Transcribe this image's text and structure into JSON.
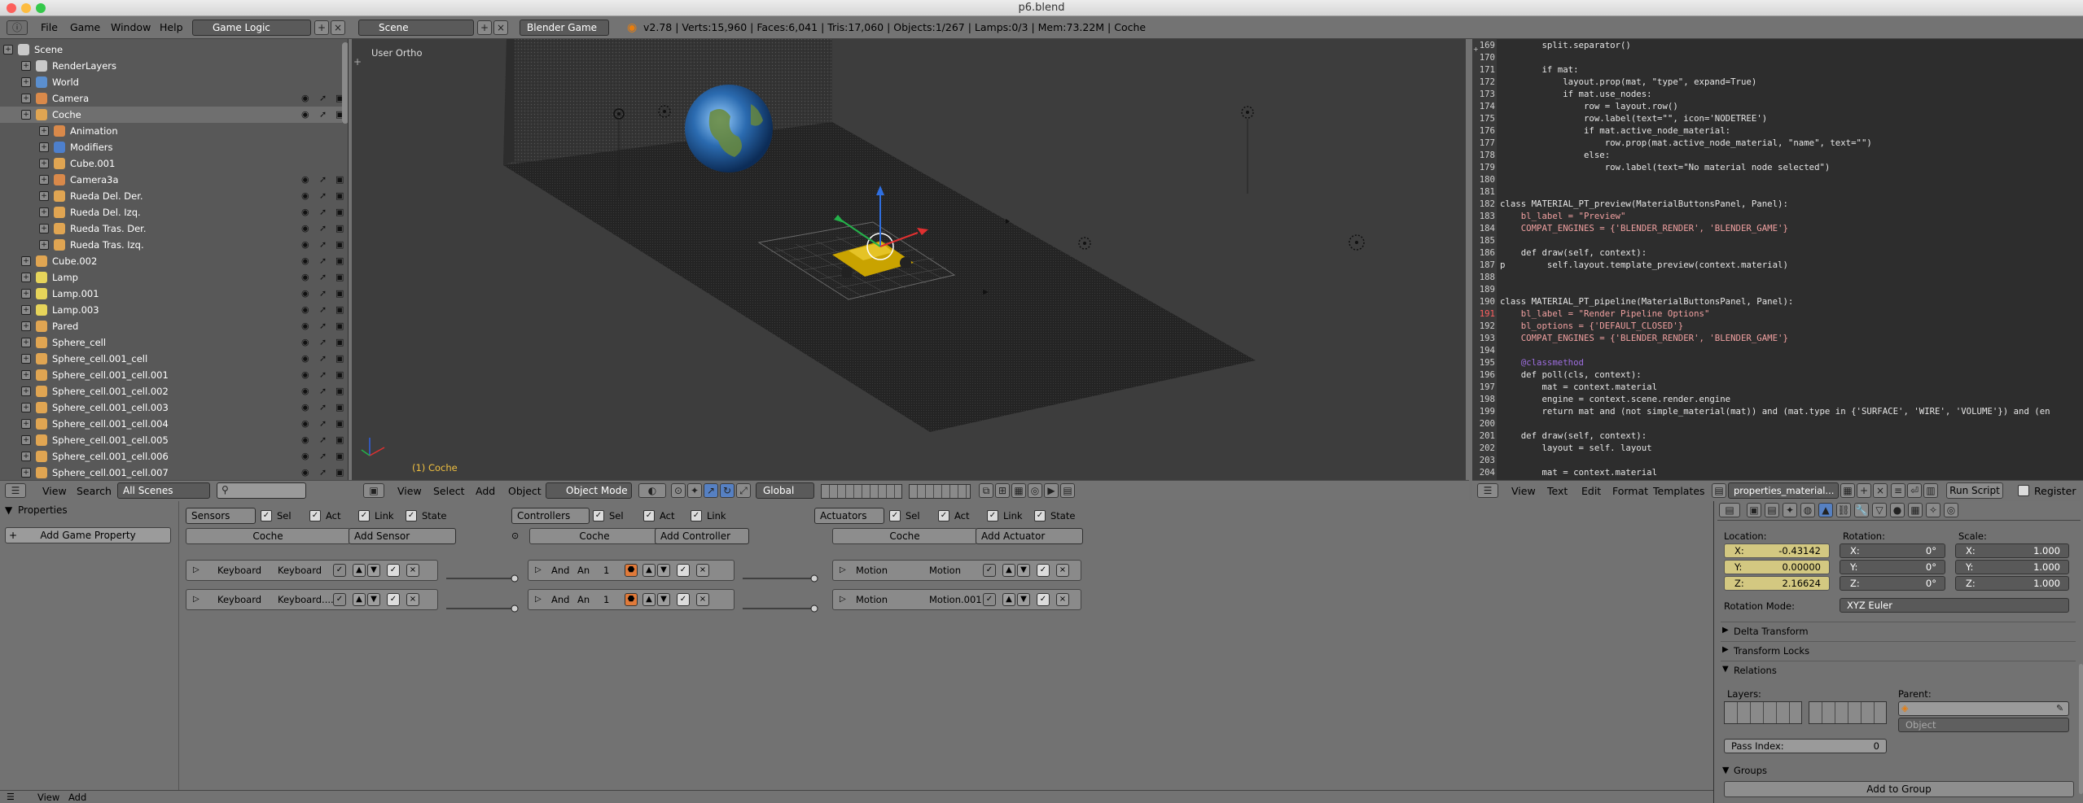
{
  "window": {
    "title": "p6.blend"
  },
  "topbar": {
    "menus": [
      "File",
      "Game",
      "Window",
      "Help"
    ],
    "screen_layout": "Game Logic",
    "scene": "Scene",
    "engine": "Blender Game",
    "stats": "v2.78 | Verts:15,960 | Faces:6,041 | Tris:17,060 | Objects:1/267 | Lamps:0/3 | Mem:73.22M | Coche"
  },
  "outliner": {
    "items": [
      {
        "label": "Scene",
        "indent": 0,
        "icon": "scene-icon"
      },
      {
        "label": "RenderLayers",
        "indent": 1,
        "icon": "renderlayers-icon"
      },
      {
        "label": "World",
        "indent": 1,
        "icon": "world-icon"
      },
      {
        "label": "Camera",
        "indent": 1,
        "icon": "camera-icon"
      },
      {
        "label": "Coche",
        "indent": 1,
        "icon": "mesh-icon"
      },
      {
        "label": "Animation",
        "indent": 2,
        "icon": "animation-icon"
      },
      {
        "label": "Modifiers",
        "indent": 2,
        "icon": "modifier-icon"
      },
      {
        "label": "Cube.001",
        "indent": 2,
        "icon": "mesh-icon"
      },
      {
        "label": "Camera3a",
        "indent": 2,
        "icon": "camera-icon"
      },
      {
        "label": "Rueda Del. Der.",
        "indent": 2,
        "icon": "mesh-icon"
      },
      {
        "label": "Rueda Del. Izq.",
        "indent": 2,
        "icon": "mesh-icon"
      },
      {
        "label": "Rueda Tras. Der.",
        "indent": 2,
        "icon": "mesh-icon"
      },
      {
        "label": "Rueda Tras. Izq.",
        "indent": 2,
        "icon": "mesh-icon"
      },
      {
        "label": "Cube.002",
        "indent": 1,
        "icon": "mesh-icon"
      },
      {
        "label": "Lamp",
        "indent": 1,
        "icon": "lamp-icon"
      },
      {
        "label": "Lamp.001",
        "indent": 1,
        "icon": "lamp-icon"
      },
      {
        "label": "Lamp.003",
        "indent": 1,
        "icon": "lamp-icon"
      },
      {
        "label": "Pared",
        "indent": 1,
        "icon": "mesh-icon"
      },
      {
        "label": "Sphere_cell",
        "indent": 1,
        "icon": "mesh-icon"
      },
      {
        "label": "Sphere_cell.001_cell",
        "indent": 1,
        "icon": "mesh-icon"
      },
      {
        "label": "Sphere_cell.001_cell.001",
        "indent": 1,
        "icon": "mesh-icon"
      },
      {
        "label": "Sphere_cell.001_cell.002",
        "indent": 1,
        "icon": "mesh-icon"
      },
      {
        "label": "Sphere_cell.001_cell.003",
        "indent": 1,
        "icon": "mesh-icon"
      },
      {
        "label": "Sphere_cell.001_cell.004",
        "indent": 1,
        "icon": "mesh-icon"
      },
      {
        "label": "Sphere_cell.001_cell.005",
        "indent": 1,
        "icon": "mesh-icon"
      },
      {
        "label": "Sphere_cell.001_cell.006",
        "indent": 1,
        "icon": "mesh-icon"
      },
      {
        "label": "Sphere_cell.001_cell.007",
        "indent": 1,
        "icon": "mesh-icon"
      }
    ],
    "header": {
      "menus": [
        "View",
        "Search"
      ],
      "filter": "All Scenes"
    }
  },
  "viewport": {
    "label": "User Ortho",
    "object_label": "(1) Coche",
    "header": {
      "menus": [
        "View",
        "Select",
        "Add",
        "Object"
      ],
      "mode": "Object Mode",
      "orientation": "Global"
    }
  },
  "text_editor": {
    "lines": [
      {
        "n": "169",
        "t": "        split.separator()"
      },
      {
        "n": "170",
        "t": ""
      },
      {
        "n": "171",
        "t": "        if mat:"
      },
      {
        "n": "172",
        "t": "            layout.prop(mat, \"type\", expand=True)"
      },
      {
        "n": "173",
        "t": "            if mat.use_nodes:"
      },
      {
        "n": "174",
        "t": "                row = layout.row()"
      },
      {
        "n": "175",
        "t": "                row.label(text=\"\", icon='NODETREE')"
      },
      {
        "n": "176",
        "t": "                if mat.active_node_material:"
      },
      {
        "n": "177",
        "t": "                    row.prop(mat.active_node_material, \"name\", text=\"\")"
      },
      {
        "n": "178",
        "t": "                else:"
      },
      {
        "n": "179",
        "t": "                    row.label(text=\"No material node selected\")"
      },
      {
        "n": "180",
        "t": ""
      },
      {
        "n": "181",
        "t": ""
      },
      {
        "n": "182",
        "t": "class MATERIAL_PT_preview(MaterialButtonsPanel, Panel):"
      },
      {
        "n": "183",
        "t": "    bl_label = \"Preview\""
      },
      {
        "n": "184",
        "t": "    COMPAT_ENGINES = {'BLENDER_RENDER', 'BLENDER_GAME'}"
      },
      {
        "n": "185",
        "t": ""
      },
      {
        "n": "186",
        "t": "    def draw(self, context):"
      },
      {
        "n": "187",
        "t": "p        self.layout.template_preview(context.material)"
      },
      {
        "n": "188",
        "t": ""
      },
      {
        "n": "189",
        "t": ""
      },
      {
        "n": "190",
        "t": "class MATERIAL_PT_pipeline(MaterialButtonsPanel, Panel):"
      },
      {
        "n": "191",
        "t": "    bl_label = \"Render Pipeline Options\""
      },
      {
        "n": "192",
        "t": "    bl_options = {'DEFAULT_CLOSED'}"
      },
      {
        "n": "193",
        "t": "    COMPAT_ENGINES = {'BLENDER_RENDER', 'BLENDER_GAME'}"
      },
      {
        "n": "194",
        "t": ""
      },
      {
        "n": "195",
        "t": "    @classmethod"
      },
      {
        "n": "196",
        "t": "    def poll(cls, context):"
      },
      {
        "n": "197",
        "t": "        mat = context.material"
      },
      {
        "n": "198",
        "t": "        engine = context.scene.render.engine"
      },
      {
        "n": "199",
        "t": "        return mat and (not simple_material(mat)) and (mat.type in {'SURFACE', 'WIRE', 'VOLUME'}) and (en"
      },
      {
        "n": "200",
        "t": ""
      },
      {
        "n": "201",
        "t": "    def draw(self, context):"
      },
      {
        "n": "202",
        "t": "        layout = self. layout"
      },
      {
        "n": "203",
        "t": ""
      },
      {
        "n": "204",
        "t": "        mat = context.material"
      }
    ],
    "header": {
      "menus": [
        "View",
        "Text",
        "Edit",
        "Format",
        "Templates"
      ],
      "file": "properties_material...",
      "run": "Run Script",
      "register": "Register"
    }
  },
  "logic": {
    "properties_title": "Properties",
    "add_game_property": "Add Game Property",
    "sensors": {
      "dropdown": "Sensors",
      "object": "Coche",
      "add": "Add Sensor",
      "items": [
        {
          "type": "Keyboard",
          "name": "Keyboard"
        },
        {
          "type": "Keyboard",
          "name": "Keyboard...."
        }
      ]
    },
    "controllers": {
      "dropdown": "Controllers",
      "object": "Coche",
      "add": "Add Controller",
      "items": [
        {
          "type": "And",
          "name": "An",
          "n": "1"
        },
        {
          "type": "And",
          "name": "An",
          "n": "1"
        }
      ]
    },
    "actuators": {
      "dropdown": "Actuators",
      "object": "Coche",
      "add": "Add Actuator",
      "items": [
        {
          "type": "Motion",
          "name": "Motion"
        },
        {
          "type": "Motion",
          "name": "Motion.001"
        }
      ]
    },
    "checks": {
      "sel": "Sel",
      "act": "Act",
      "link": "Link",
      "state": "State"
    },
    "footer": {
      "view": "View",
      "add": "Add"
    }
  },
  "properties": {
    "location_label": "Location:",
    "rotation_label": "Rotation:",
    "scale_label": "Scale:",
    "location": [
      "-0.43142",
      "0.00000",
      "2.16624"
    ],
    "rotation": [
      "0°",
      "0°",
      "0°"
    ],
    "scale": [
      "1.000",
      "1.000",
      "1.000"
    ],
    "axes": [
      "X:",
      "Y:",
      "Z:"
    ],
    "rotation_mode_label": "Rotation Mode:",
    "rotation_mode": "XYZ Euler",
    "panels": [
      "Delta Transform",
      "Transform Locks",
      "Relations"
    ],
    "layers_label": "Layers:",
    "parent_label": "Parent:",
    "parent_type": "Object",
    "pass_index_label": "Pass Index:",
    "pass_index": "0",
    "groups": "Groups",
    "add_to_group": "Add to Group"
  },
  "colors": {
    "accent": "#5680c2",
    "selected_field": "#d3c881",
    "earth_ocean": "#2b6bb0"
  }
}
